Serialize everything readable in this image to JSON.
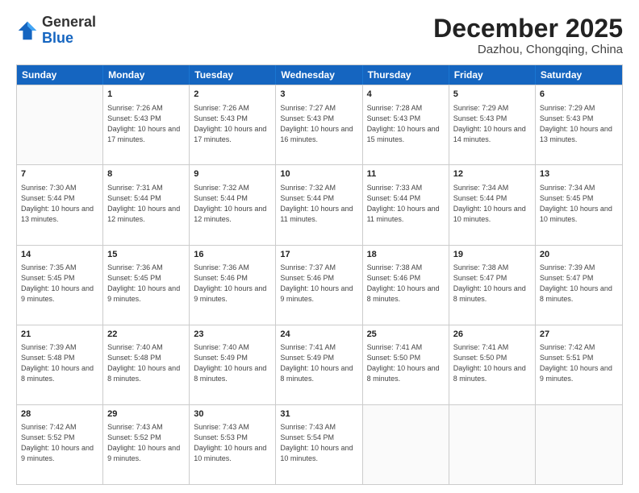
{
  "logo": {
    "general": "General",
    "blue": "Blue"
  },
  "header": {
    "month_title": "December 2025",
    "location": "Dazhou, Chongqing, China"
  },
  "weekdays": [
    "Sunday",
    "Monday",
    "Tuesday",
    "Wednesday",
    "Thursday",
    "Friday",
    "Saturday"
  ],
  "rows": [
    [
      {
        "day": "",
        "info": ""
      },
      {
        "day": "1",
        "sunrise": "7:26 AM",
        "sunset": "5:43 PM",
        "daylight": "10 hours and 17 minutes."
      },
      {
        "day": "2",
        "sunrise": "7:26 AM",
        "sunset": "5:43 PM",
        "daylight": "10 hours and 17 minutes."
      },
      {
        "day": "3",
        "sunrise": "7:27 AM",
        "sunset": "5:43 PM",
        "daylight": "10 hours and 16 minutes."
      },
      {
        "day": "4",
        "sunrise": "7:28 AM",
        "sunset": "5:43 PM",
        "daylight": "10 hours and 15 minutes."
      },
      {
        "day": "5",
        "sunrise": "7:29 AM",
        "sunset": "5:43 PM",
        "daylight": "10 hours and 14 minutes."
      },
      {
        "day": "6",
        "sunrise": "7:29 AM",
        "sunset": "5:43 PM",
        "daylight": "10 hours and 13 minutes."
      }
    ],
    [
      {
        "day": "7",
        "sunrise": "7:30 AM",
        "sunset": "5:44 PM",
        "daylight": "10 hours and 13 minutes."
      },
      {
        "day": "8",
        "sunrise": "7:31 AM",
        "sunset": "5:44 PM",
        "daylight": "10 hours and 12 minutes."
      },
      {
        "day": "9",
        "sunrise": "7:32 AM",
        "sunset": "5:44 PM",
        "daylight": "10 hours and 12 minutes."
      },
      {
        "day": "10",
        "sunrise": "7:32 AM",
        "sunset": "5:44 PM",
        "daylight": "10 hours and 11 minutes."
      },
      {
        "day": "11",
        "sunrise": "7:33 AM",
        "sunset": "5:44 PM",
        "daylight": "10 hours and 11 minutes."
      },
      {
        "day": "12",
        "sunrise": "7:34 AM",
        "sunset": "5:44 PM",
        "daylight": "10 hours and 10 minutes."
      },
      {
        "day": "13",
        "sunrise": "7:34 AM",
        "sunset": "5:45 PM",
        "daylight": "10 hours and 10 minutes."
      }
    ],
    [
      {
        "day": "14",
        "sunrise": "7:35 AM",
        "sunset": "5:45 PM",
        "daylight": "10 hours and 9 minutes."
      },
      {
        "day": "15",
        "sunrise": "7:36 AM",
        "sunset": "5:45 PM",
        "daylight": "10 hours and 9 minutes."
      },
      {
        "day": "16",
        "sunrise": "7:36 AM",
        "sunset": "5:46 PM",
        "daylight": "10 hours and 9 minutes."
      },
      {
        "day": "17",
        "sunrise": "7:37 AM",
        "sunset": "5:46 PM",
        "daylight": "10 hours and 9 minutes."
      },
      {
        "day": "18",
        "sunrise": "7:38 AM",
        "sunset": "5:46 PM",
        "daylight": "10 hours and 8 minutes."
      },
      {
        "day": "19",
        "sunrise": "7:38 AM",
        "sunset": "5:47 PM",
        "daylight": "10 hours and 8 minutes."
      },
      {
        "day": "20",
        "sunrise": "7:39 AM",
        "sunset": "5:47 PM",
        "daylight": "10 hours and 8 minutes."
      }
    ],
    [
      {
        "day": "21",
        "sunrise": "7:39 AM",
        "sunset": "5:48 PM",
        "daylight": "10 hours and 8 minutes."
      },
      {
        "day": "22",
        "sunrise": "7:40 AM",
        "sunset": "5:48 PM",
        "daylight": "10 hours and 8 minutes."
      },
      {
        "day": "23",
        "sunrise": "7:40 AM",
        "sunset": "5:49 PM",
        "daylight": "10 hours and 8 minutes."
      },
      {
        "day": "24",
        "sunrise": "7:41 AM",
        "sunset": "5:49 PM",
        "daylight": "10 hours and 8 minutes."
      },
      {
        "day": "25",
        "sunrise": "7:41 AM",
        "sunset": "5:50 PM",
        "daylight": "10 hours and 8 minutes."
      },
      {
        "day": "26",
        "sunrise": "7:41 AM",
        "sunset": "5:50 PM",
        "daylight": "10 hours and 8 minutes."
      },
      {
        "day": "27",
        "sunrise": "7:42 AM",
        "sunset": "5:51 PM",
        "daylight": "10 hours and 9 minutes."
      }
    ],
    [
      {
        "day": "28",
        "sunrise": "7:42 AM",
        "sunset": "5:52 PM",
        "daylight": "10 hours and 9 minutes."
      },
      {
        "day": "29",
        "sunrise": "7:43 AM",
        "sunset": "5:52 PM",
        "daylight": "10 hours and 9 minutes."
      },
      {
        "day": "30",
        "sunrise": "7:43 AM",
        "sunset": "5:53 PM",
        "daylight": "10 hours and 10 minutes."
      },
      {
        "day": "31",
        "sunrise": "7:43 AM",
        "sunset": "5:54 PM",
        "daylight": "10 hours and 10 minutes."
      },
      {
        "day": "",
        "info": ""
      },
      {
        "day": "",
        "info": ""
      },
      {
        "day": "",
        "info": ""
      }
    ]
  ]
}
